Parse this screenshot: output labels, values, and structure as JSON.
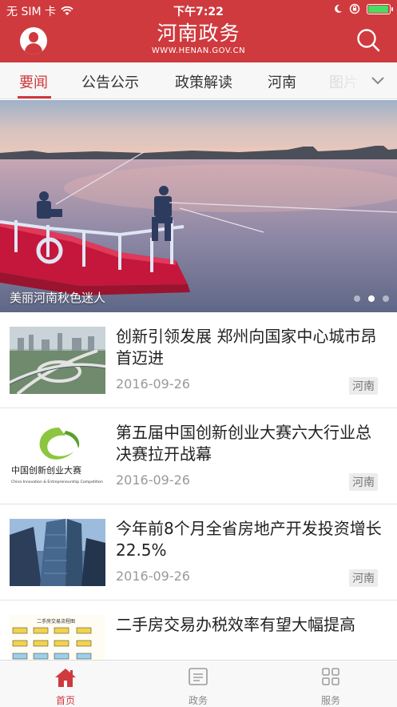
{
  "status_bar": {
    "carrier": "无 SIM 卡",
    "time": "下午7:22",
    "battery_level": 1.0
  },
  "header": {
    "title": "河南政务",
    "subtitle": "WWW.HENAN.GOV.CN",
    "icons": [
      "avatar-icon",
      "search-icon"
    ]
  },
  "tabs": [
    "要闻",
    "公告公示",
    "政策解读",
    "河南",
    "图片"
  ],
  "active_tab": "要闻",
  "banner": {
    "caption": "美丽河南秋色迷人",
    "slide_index": 2,
    "slide_count": 3
  },
  "news": [
    {
      "title": "创新引领发展 郑州向国家中心城市昂首迈进",
      "date": "2016-09-26",
      "tag": "河南"
    },
    {
      "title": "第五届中国创新创业大赛六大行业总决赛拉开战幕",
      "date": "2016-09-26",
      "tag": "河南"
    },
    {
      "title": "今年前8个月全省房地产开发投资增长22.5%",
      "date": "2016-09-26",
      "tag": "河南"
    },
    {
      "title": "二手房交易办税效率有望大幅提高",
      "date": "",
      "tag": ""
    }
  ],
  "thumbnails": {
    "logo_text": "中国创新创业大赛",
    "logo_sub": "China Innovation & Entrepreneurship Competition",
    "chart_heading": "二手房交易流程图"
  },
  "tabbar": [
    {
      "label": "首页",
      "icon": "home-icon",
      "active": true
    },
    {
      "label": "政务",
      "icon": "document-icon",
      "active": false
    },
    {
      "label": "服务",
      "icon": "grid-icon",
      "active": false
    }
  ],
  "colors": {
    "brand_red": "#cf3a3e",
    "battery_green": "#4cd964"
  }
}
